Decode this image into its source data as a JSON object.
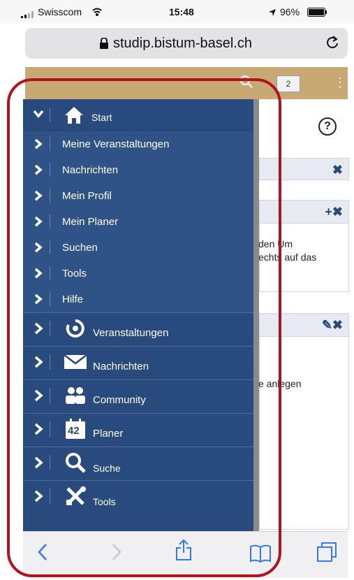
{
  "status_bar": {
    "carrier": "Swisscom",
    "time": "15:48",
    "battery": "96%"
  },
  "browser": {
    "url": "studip.bistum-basel.ch"
  },
  "app_header": {
    "badge_count": "2"
  },
  "background": {
    "text_1": "den Um",
    "text_2": "echts auf das",
    "text_3": "e anlegen"
  },
  "menu": {
    "start": "Start",
    "sub_items": [
      "Meine Veranstaltungen",
      "Nachrichten",
      "Mein Profil",
      "Mein Planer",
      "Suchen",
      "Tools",
      "Hilfe"
    ],
    "items": [
      {
        "label": "Veranstaltungen",
        "icon": "target-icon"
      },
      {
        "label": "Nachrichten",
        "icon": "envelope-icon"
      },
      {
        "label": "Community",
        "icon": "people-icon"
      },
      {
        "label": "Planer",
        "icon": "calendar-icon",
        "icon_text": "42"
      },
      {
        "label": "Suche",
        "icon": "magnifier-icon"
      },
      {
        "label": "Tools",
        "icon": "tools-icon"
      }
    ]
  },
  "colors": {
    "menu_bg": "#284a7d",
    "header_bg": "#c9a973",
    "highlight_frame": "#b0141c"
  }
}
